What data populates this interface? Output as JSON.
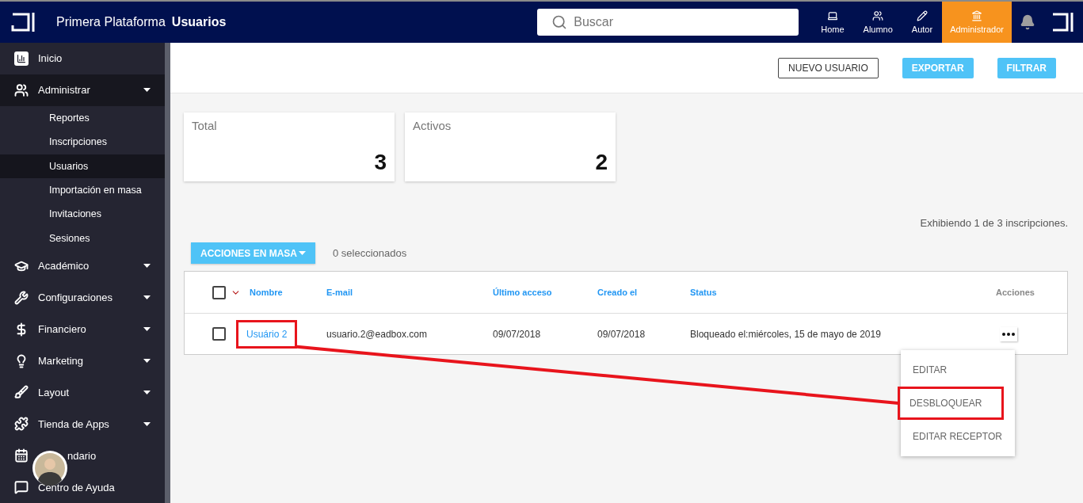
{
  "topbar": {
    "platform": "Primera Plataforma",
    "page": "Usuarios",
    "search": {
      "placeholder": "Buscar"
    },
    "roles": [
      {
        "label": "Home",
        "selected": false
      },
      {
        "label": "Alumno",
        "selected": false
      },
      {
        "label": "Autor",
        "selected": false
      },
      {
        "label": "Administrador",
        "selected": true
      }
    ]
  },
  "sidebar": {
    "items": [
      {
        "label": "Inicio"
      },
      {
        "label": "Administrar",
        "expanded": true,
        "children": [
          {
            "label": "Reportes",
            "selected": false
          },
          {
            "label": "Inscripciones",
            "selected": false
          },
          {
            "label": "Usuarios",
            "selected": true
          },
          {
            "label": "Importación en masa",
            "selected": false
          },
          {
            "label": "Invitaciones",
            "selected": false
          },
          {
            "label": "Sesiones",
            "selected": false
          }
        ]
      },
      {
        "label": "Académico",
        "expanded": false
      },
      {
        "label": "Configuraciones",
        "expanded": false
      },
      {
        "label": "Financiero",
        "expanded": false
      },
      {
        "label": "Marketing",
        "expanded": false
      },
      {
        "label": "Layout",
        "expanded": false
      },
      {
        "label": "Tienda de Apps",
        "expanded": false
      },
      {
        "label": "ndario"
      },
      {
        "label": "Centro de Ayuda"
      }
    ]
  },
  "toolbar": {
    "buttons": [
      {
        "label": "NUEVO USUARIO",
        "kind": "outline"
      },
      {
        "label": "EXPORTAR",
        "kind": "filled"
      },
      {
        "label": "FILTRAR",
        "kind": "filled"
      }
    ]
  },
  "stats": [
    {
      "label": "Total",
      "value": "3"
    },
    {
      "label": "Activos",
      "value": "2"
    }
  ],
  "summary": "Exhibiendo 1 de 3 inscripciones.",
  "bulk": {
    "button": "ACCIONES EN MASA",
    "selected_count": "0 seleccionados"
  },
  "table": {
    "columns": [
      "Nombre",
      "E-mail",
      "Último acceso",
      "Creado el",
      "Status",
      "Acciones"
    ],
    "rows": [
      {
        "checked": false,
        "name": "Usuário 2",
        "email": "usuario.2@eadbox.com",
        "last_access": "09/07/2018",
        "created": "09/07/2018",
        "status": "Bloqueado el:miércoles, 15 de mayo de 2019",
        "highlighted": true,
        "actions_open": true
      }
    ],
    "header_checked": false
  },
  "action_menu": [
    {
      "label": "EDITAR",
      "highlighted": false
    },
    {
      "label": "DESBLOQUEAR",
      "highlighted": true
    },
    {
      "label": "EDITAR RECEPTOR",
      "highlighted": false
    }
  ]
}
